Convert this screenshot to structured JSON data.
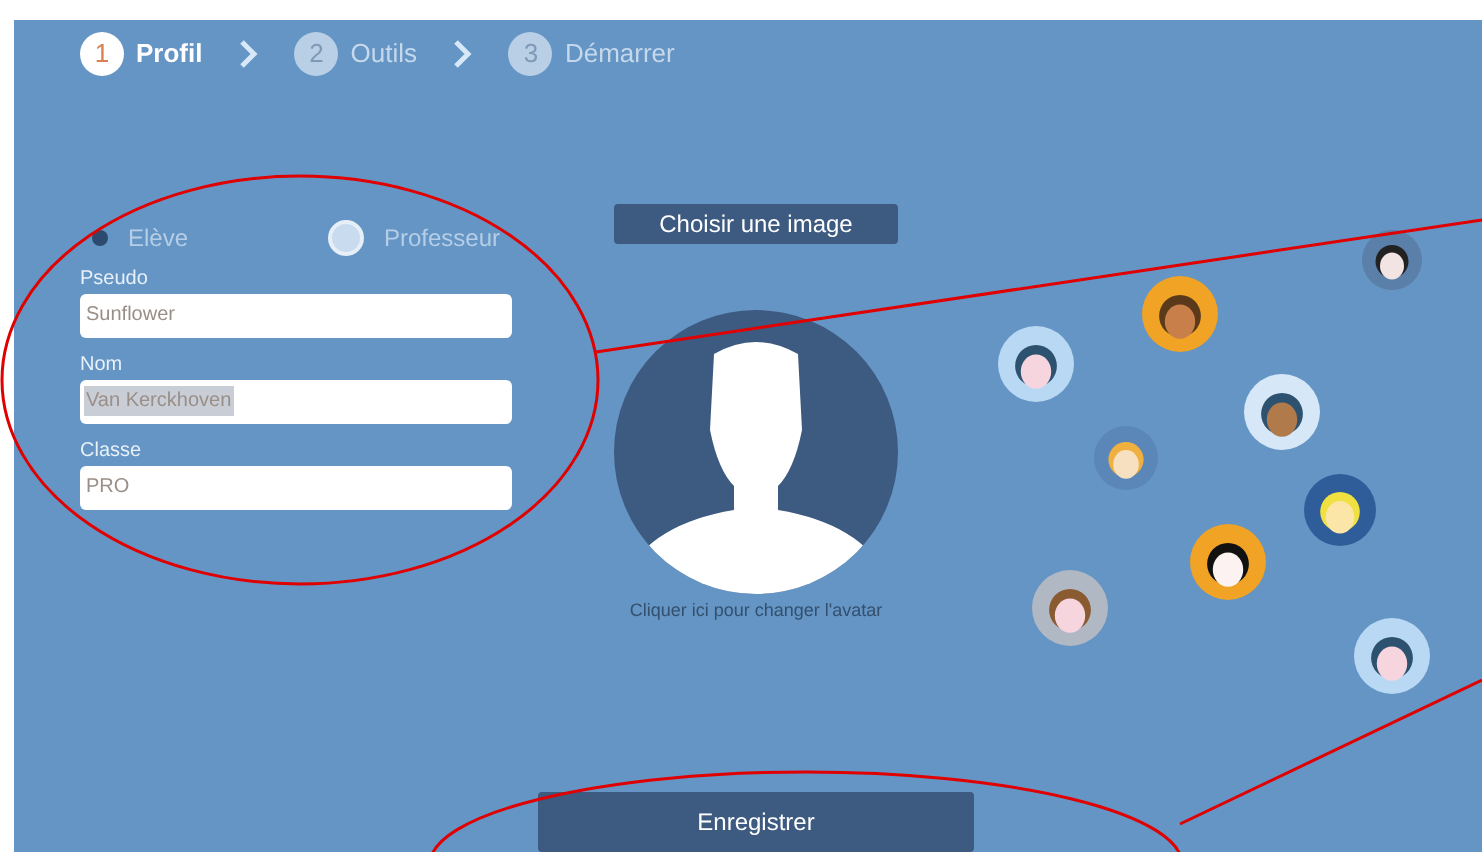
{
  "steps": [
    {
      "number": "1",
      "label": "Profil",
      "selected": true
    },
    {
      "number": "2",
      "label": "Outils",
      "selected": false
    },
    {
      "number": "3",
      "label": "Démarrer",
      "selected": false
    }
  ],
  "roles": [
    {
      "label": "Elève",
      "selected": true
    },
    {
      "label": "Professeur",
      "selected": false
    }
  ],
  "fields": [
    {
      "label": "Pseudo",
      "value": "Sunflower",
      "text_selected": false
    },
    {
      "label": "Nom",
      "value": "Van Kerckhoven",
      "text_selected": true
    },
    {
      "label": "Classe",
      "value": "PRO",
      "text_selected": false
    }
  ],
  "choose_image_button": "Choisir une image",
  "avatar_caption": "Cliquer ici pour changer l'avatar",
  "save_button": "Enregistrer"
}
